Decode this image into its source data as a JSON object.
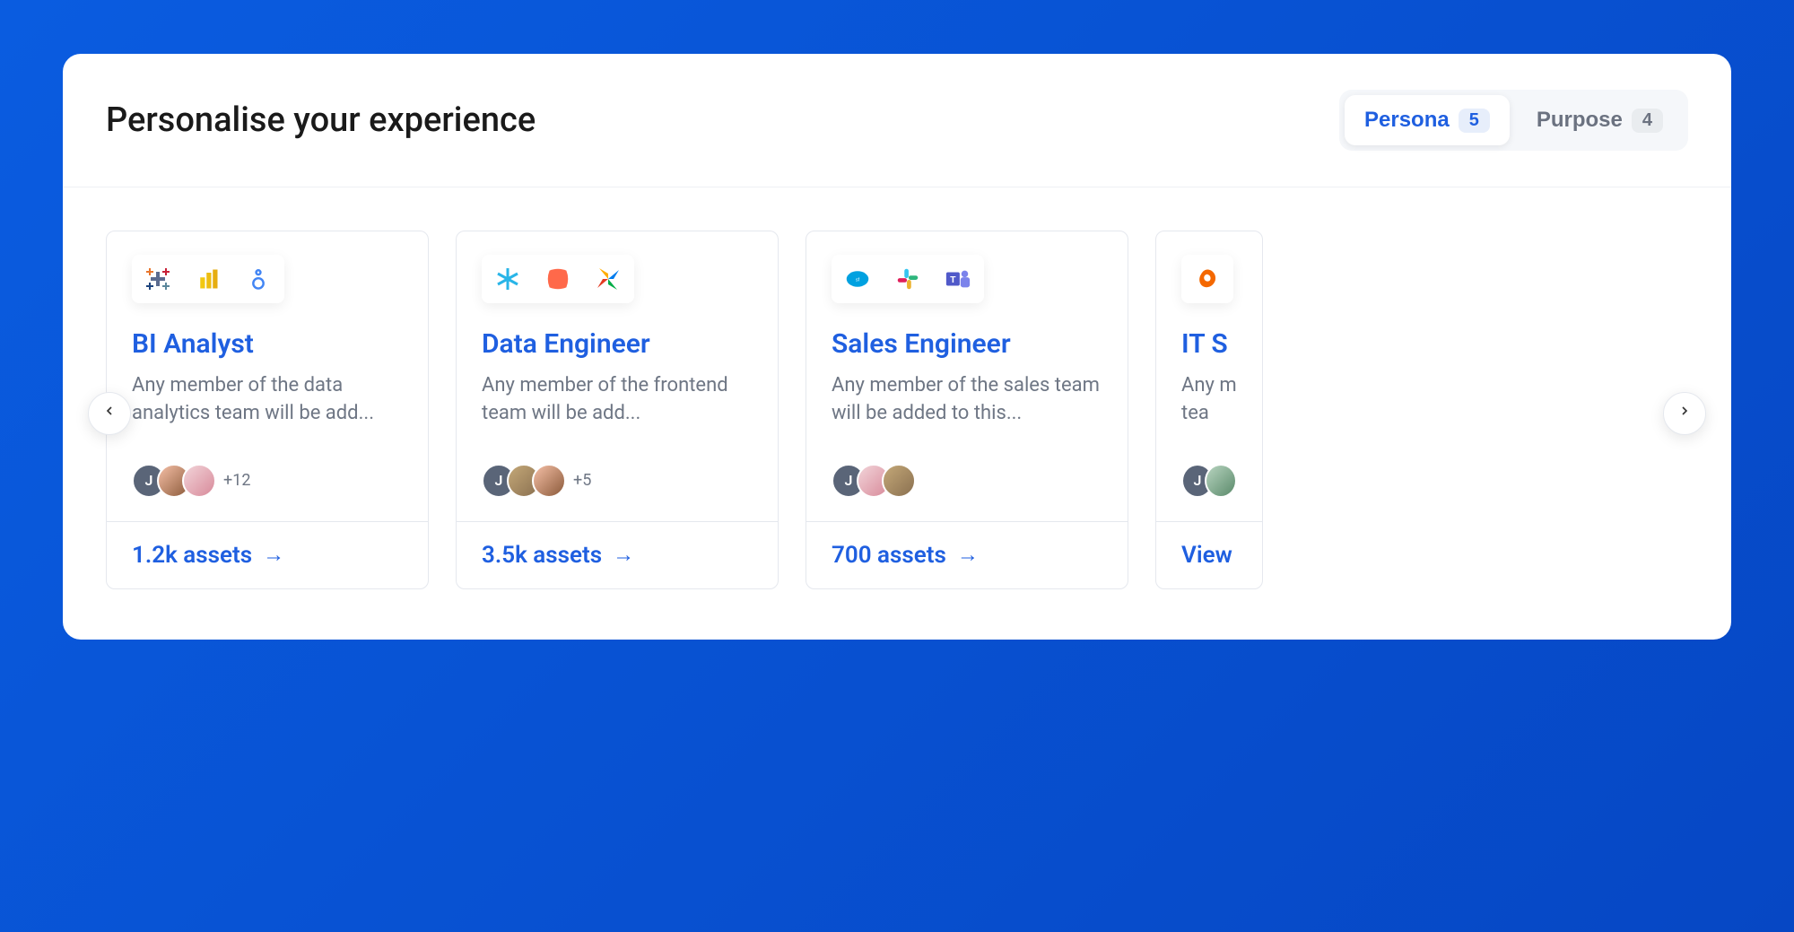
{
  "header": {
    "title": "Personalise your experience"
  },
  "tabs": [
    {
      "label": "Persona",
      "count": "5",
      "active": true
    },
    {
      "label": "Purpose",
      "count": "4",
      "active": false
    }
  ],
  "cards": [
    {
      "title": "BI Analyst",
      "description": "Any member of the data analytics team will be add...",
      "icons": [
        "tableau-icon",
        "powerbi-icon",
        "looker-icon"
      ],
      "avatars_extra": "+12",
      "footer": "1.2k assets"
    },
    {
      "title": "Data Engineer",
      "description": "Any member of the frontend team will be add...",
      "icons": [
        "snowflake-icon",
        "dbt-icon",
        "airflow-icon"
      ],
      "avatars_extra": "+5",
      "footer": "3.5k assets"
    },
    {
      "title": "Sales Engineer",
      "description": "Any member of the sales team will be added to this...",
      "icons": [
        "salesforce-icon",
        "slack-icon",
        "teams-icon"
      ],
      "avatars_extra": "",
      "footer": "700 assets"
    },
    {
      "title": "IT S",
      "description": "Any m tea",
      "icons": [
        "grafana-icon"
      ],
      "avatars_extra": "",
      "footer": "View"
    }
  ]
}
